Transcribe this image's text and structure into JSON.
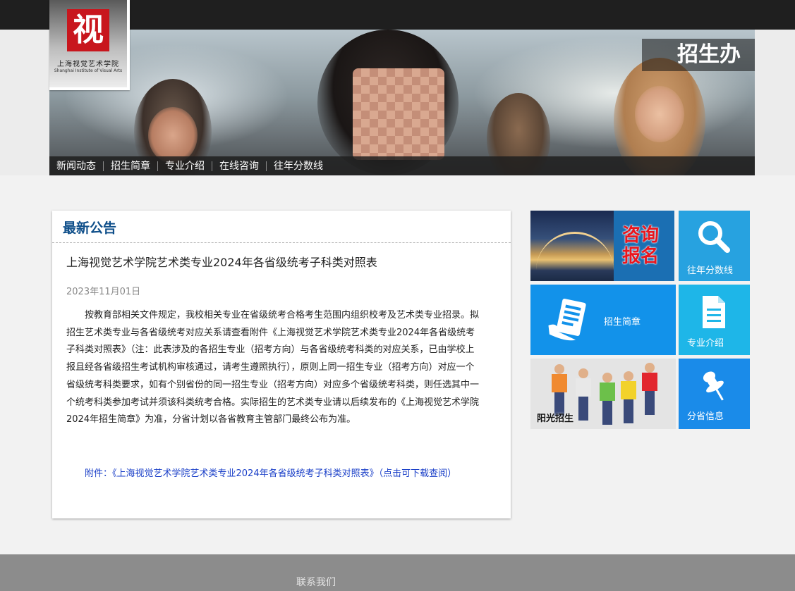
{
  "logo": {
    "seal_char": "视",
    "name_cn": "上海视觉艺术学院",
    "name_en": "Shanghai Institute of Visual Arts"
  },
  "office_tag": "招生办",
  "nav": [
    "新闻动态",
    "招生简章",
    "专业介绍",
    "在线咨询",
    "往年分数线"
  ],
  "notice": {
    "heading": "最新公告",
    "title": "上海视觉艺术学院艺术类专业2024年各省级统考子科类对照表",
    "date": "2023年11月01日",
    "body": "按教育部相关文件规定，我校相关专业在省级统考合格考生范围内组织校考及艺术类专业招录。拟招生艺术类专业与各省级统考对应关系请查看附件《上海视觉艺术学院艺术类专业2024年各省级统考子科类对照表》（注：此表涉及的各招生专业（招考方向）与各省级统考科类的对应关系，已由学校上报且经各省级招生考试机构审核通过，请考生遵照执行），原则上同一招生专业（招考方向）对应一个省级统考科类要求，如有个别省份的同一招生专业（招考方向）对应多个省级统考科类，则任选其中一个统考科类参加考试并须该科类统考合格。实际招生的艺术类专业请以后续发布的《上海视觉艺术学院2024年招生简章》为准，分省计划以各省教育主管部门最终公布为准。",
    "attachment": "附件：《上海视觉艺术学院艺术类专业2024年各省级统考子科类对照表》（点击可下载查阅）"
  },
  "tiles": {
    "consult": "咨询报名",
    "scores": "往年分数线",
    "brochure": "招生简章",
    "majors": "专业介绍",
    "sunshine": "阳光招生",
    "province": "分省信息"
  },
  "footer": {
    "contact": "联系我们"
  },
  "colors": {
    "heading": "#0f4f8a",
    "link": "#1a3fc8",
    "tile_blue": "#1292ea"
  }
}
